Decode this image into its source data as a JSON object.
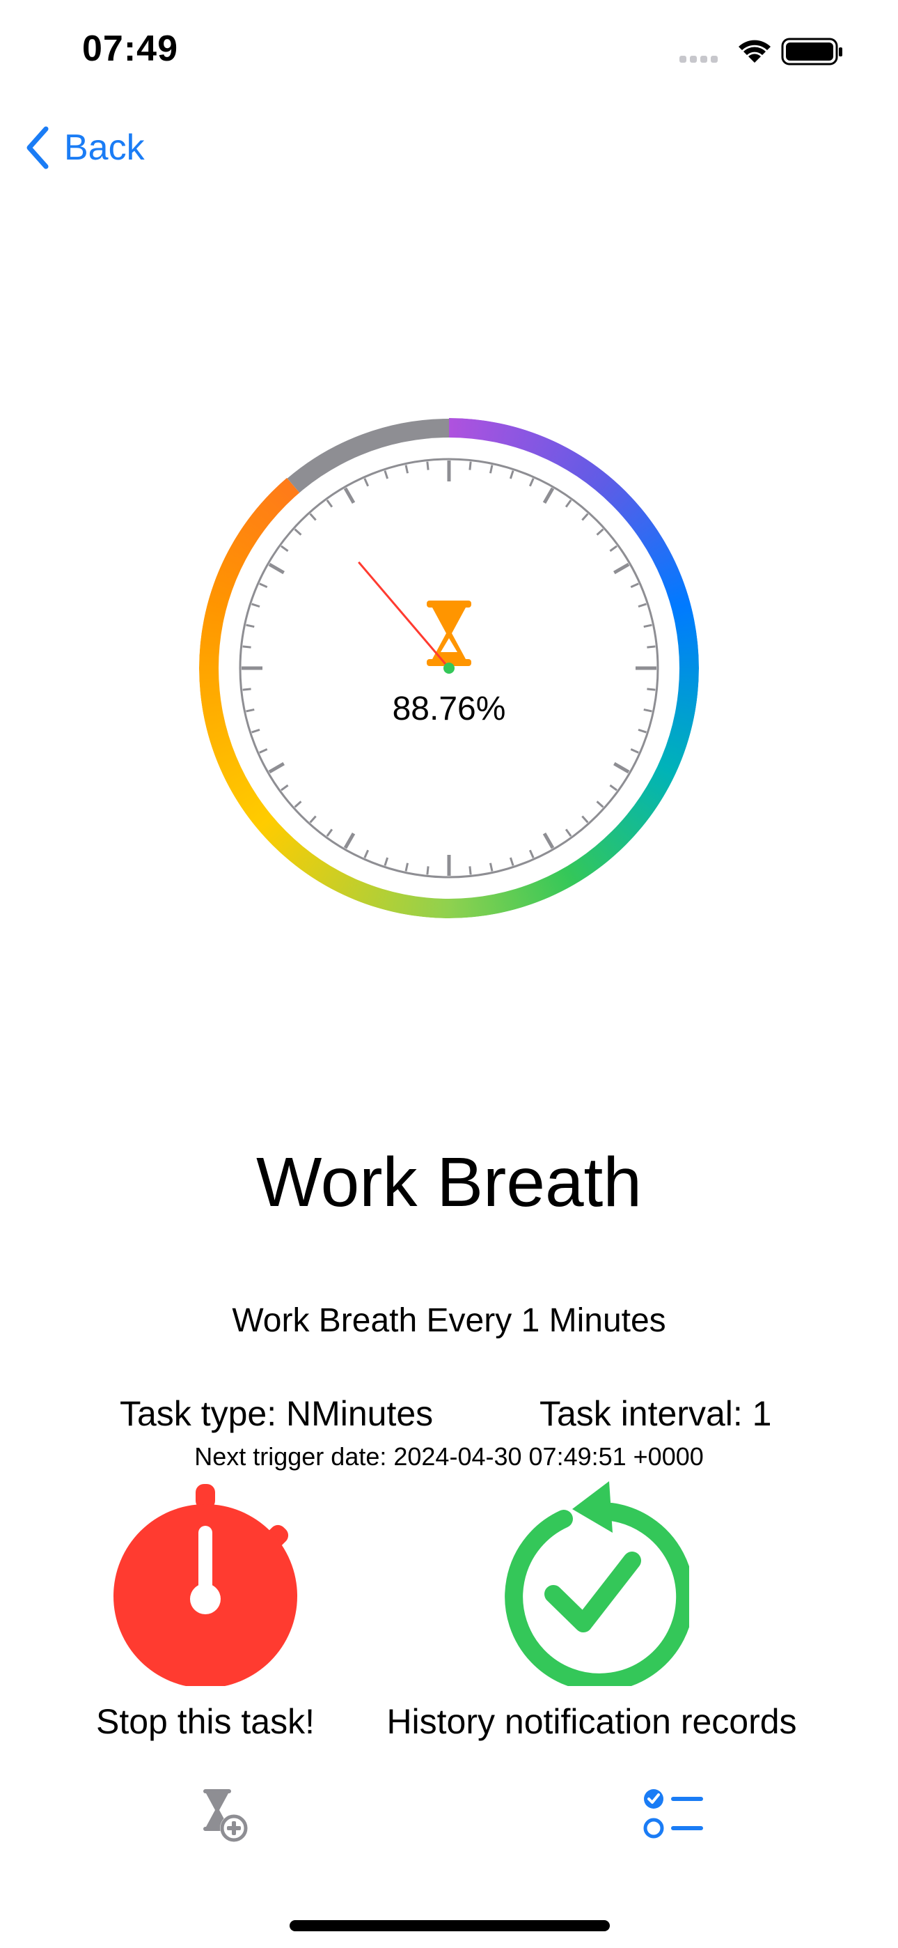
{
  "status_bar": {
    "time": "07:49"
  },
  "nav": {
    "back_label": "Back"
  },
  "dial": {
    "percent_text": "88.76%",
    "progress_fraction": 0.8876,
    "center_icon": "hourglass-icon",
    "colors": {
      "remaining": "#8e8e93",
      "needle": "#ff3b30",
      "center_dot": "#34c759",
      "hourglass": "#ff9500"
    }
  },
  "task": {
    "title": "Work Breath",
    "description": "Work Breath Every 1 Minutes",
    "type_text": "Task type:  NMinutes",
    "interval_text": "Task interval:  1",
    "next_trigger_text": "Next trigger date:   2024-04-30 07:49:51 +0000"
  },
  "actions": {
    "stop_label": "Stop this task!",
    "stop_icon": "stopwatch-icon",
    "stop_color": "#ff3b30",
    "history_label": "History notification records",
    "history_icon": "refresh-check-icon",
    "history_color": "#34c759"
  },
  "tab_bar": {
    "items": [
      {
        "icon": "add-timer-icon",
        "color": "#8e8e93"
      },
      {
        "icon": "checklist-icon",
        "color": "#1a7cf5"
      }
    ]
  },
  "accent": "#1a7cf5"
}
